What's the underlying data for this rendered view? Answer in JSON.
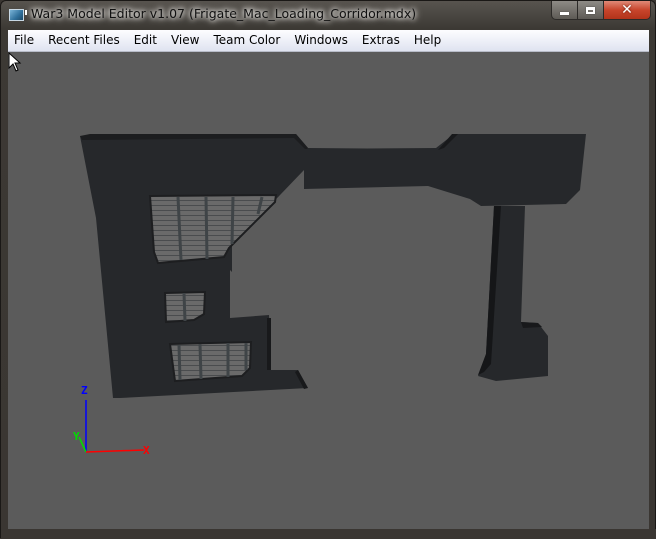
{
  "window": {
    "title": "War3 Model Editor v1.07 (Frigate_Mac_Loading_Corridor.mdx)",
    "app_icon": "war3-model-editor-icon",
    "controls": {
      "minimize_icon": "minimize-icon",
      "maximize_icon": "maximize-icon",
      "close_icon": "close-icon"
    }
  },
  "menubar": {
    "items": [
      {
        "label": "File"
      },
      {
        "label": "Recent Files"
      },
      {
        "label": "Edit"
      },
      {
        "label": "View"
      },
      {
        "label": "Team Color"
      },
      {
        "label": "Windows"
      },
      {
        "label": "Extras"
      },
      {
        "label": "Help"
      }
    ]
  },
  "viewport": {
    "background_color": "#5b5b5b",
    "model_color": "#25272a",
    "grate_color": "#6e6e6e",
    "axes": {
      "x": {
        "label": "X",
        "color": "#ff0000"
      },
      "y": {
        "label": "Y",
        "color": "#00dd00"
      },
      "z": {
        "label": "Z",
        "color": "#0000ff"
      }
    },
    "cursor_icon": "mouse-pointer-icon"
  }
}
